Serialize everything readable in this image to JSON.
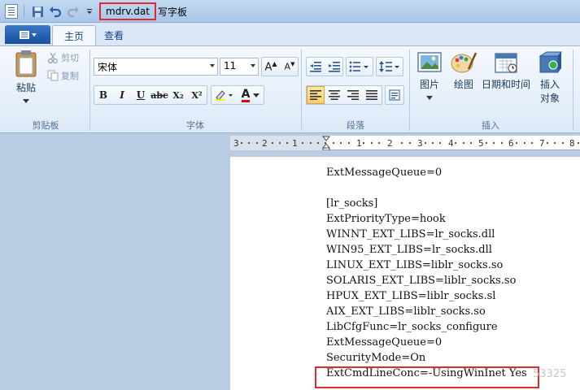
{
  "titlebar": {
    "doc_name": "mdrv.dat",
    "app_name": "写字板"
  },
  "tabs": [
    {
      "label": "主页",
      "active": true
    },
    {
      "label": "查看",
      "active": false
    }
  ],
  "ribbon": {
    "clipboard": {
      "paste_label": "粘贴",
      "cut_label": "剪切",
      "copy_label": "复制",
      "group_label": "剪贴板"
    },
    "font": {
      "font_name": "宋体",
      "font_size": "11",
      "group_label": "字体",
      "bold": "B",
      "italic": "I",
      "underline": "U",
      "strike": "abc",
      "subscript": "X₂",
      "superscript": "X²",
      "font_color": "A"
    },
    "paragraph": {
      "group_label": "段落"
    },
    "insert": {
      "picture_label": "图片",
      "paint_label": "绘图",
      "datetime_label": "日期和时间",
      "object_label_1": "插入",
      "object_label_2": "对象",
      "group_label": "插入"
    }
  },
  "ruler": {
    "labels": [
      "3",
      "2",
      "1",
      "1",
      "2",
      "3",
      "4",
      "5",
      "6",
      "7",
      "8"
    ]
  },
  "document": {
    "lines": [
      "ExtMessageQueue=0",
      "",
      "[lr_socks]",
      "ExtPriorityType=hook",
      "WINNT_EXT_LIBS=lr_socks.dll",
      "WIN95_EXT_LIBS=lr_socks.dll",
      "LINUX_EXT_LIBS=liblr_socks.so",
      "SOLARIS_EXT_LIBS=liblr_socks.so",
      "HPUX_EXT_LIBS=liblr_socks.sl",
      "AIX_EXT_LIBS=liblr_socks.so",
      "LibCfgFunc=lr_socks_configure",
      "ExtMessageQueue=0",
      "SecurityMode=On",
      "ExtCmdLineConc=-UsingWinInet Yes"
    ],
    "watermark": "53325"
  },
  "colors": {
    "highlight": "#e22b2b",
    "ribbon_bg": "#dde9f7",
    "workspace_bg": "#b8cde3"
  }
}
